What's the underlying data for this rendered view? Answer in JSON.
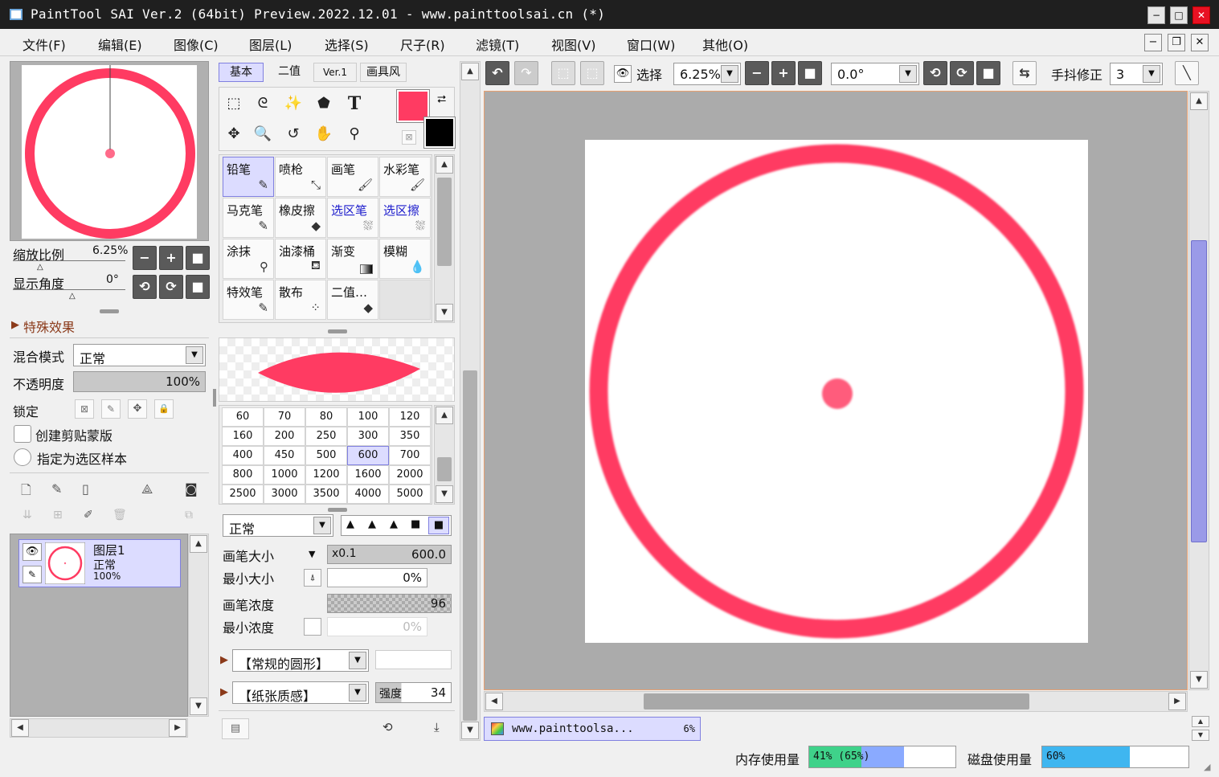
{
  "window": {
    "title": "PaintTool SAI Ver.2 (64bit) Preview.2022.12.01 - www.painttoolsai.cn (*)",
    "controls": [
      "−",
      "□",
      "✕"
    ]
  },
  "menu": [
    "文件(F)",
    "编辑(E)",
    "图像(C)",
    "图层(L)",
    "选择(S)",
    "尺子(R)",
    "滤镜(T)",
    "视图(V)",
    "窗口(W)",
    "其他(O)"
  ],
  "navigator": {
    "zoom_label": "缩放比例",
    "zoom_value": "6.25%",
    "angle_label": "显示角度",
    "angle_value": "0°"
  },
  "effects": {
    "title": "特殊效果"
  },
  "layer_props": {
    "blend_label": "混合模式",
    "blend_value": "正常",
    "opacity_label": "不透明度",
    "opacity_value": "100%",
    "lock_label": "锁定",
    "clip_label": "创建剪贴蒙版",
    "select_src_label": "指定为选区样本"
  },
  "layers": [
    {
      "name": "图层1",
      "mode": "正常",
      "opacity": "100%"
    }
  ],
  "tool_tabs": [
    "基本",
    "二值",
    "Ver.1",
    "画具风"
  ],
  "colors": {
    "primary": "#ff3b62",
    "secondary": "#000000",
    "accent_select": "#dcdcff"
  },
  "brushes": [
    [
      "铅笔",
      "喷枪",
      "画笔",
      "水彩笔"
    ],
    [
      "马克笔",
      "橡皮擦",
      "选区笔",
      "选区擦"
    ],
    [
      "涂抹",
      "油漆桶",
      "渐变",
      "模糊"
    ],
    [
      "特效笔",
      "散布",
      "二值…",
      ""
    ]
  ],
  "sizes": [
    [
      "60",
      "70",
      "80",
      "100",
      "120"
    ],
    [
      "160",
      "200",
      "250",
      "300",
      "350"
    ],
    [
      "400",
      "450",
      "500",
      "600",
      "700"
    ],
    [
      "800",
      "1000",
      "1200",
      "1600",
      "2000"
    ],
    [
      "2500",
      "3000",
      "3500",
      "4000",
      "5000"
    ]
  ],
  "brush_settings": {
    "mode": "正常",
    "size_label": "画笔大小",
    "size_mult": "x0.1",
    "size_value": "600.0",
    "min_size_label": "最小大小",
    "min_size_value": "0%",
    "density_label": "画笔浓度",
    "density_value": "96",
    "min_density_label": "最小浓度",
    "min_density_value": "0%",
    "shape": "【常规的圆形】",
    "texture": "【纸张质感】",
    "strength_label": "强度",
    "strength_value": "34"
  },
  "canvas_toolbar": {
    "select_label": "选择",
    "zoom": "6.25%",
    "angle": "0.0°",
    "stabilizer_label": "手抖修正",
    "stabilizer_value": "3"
  },
  "document_tab": {
    "name": "www.painttoolsa...",
    "zoom": "6%"
  },
  "status": {
    "memory_label": "内存使用量",
    "memory_value": "41% (65%)",
    "memory_pct": 41,
    "disk_label": "磁盘使用量",
    "disk_value": "60%",
    "disk_pct": 60
  }
}
